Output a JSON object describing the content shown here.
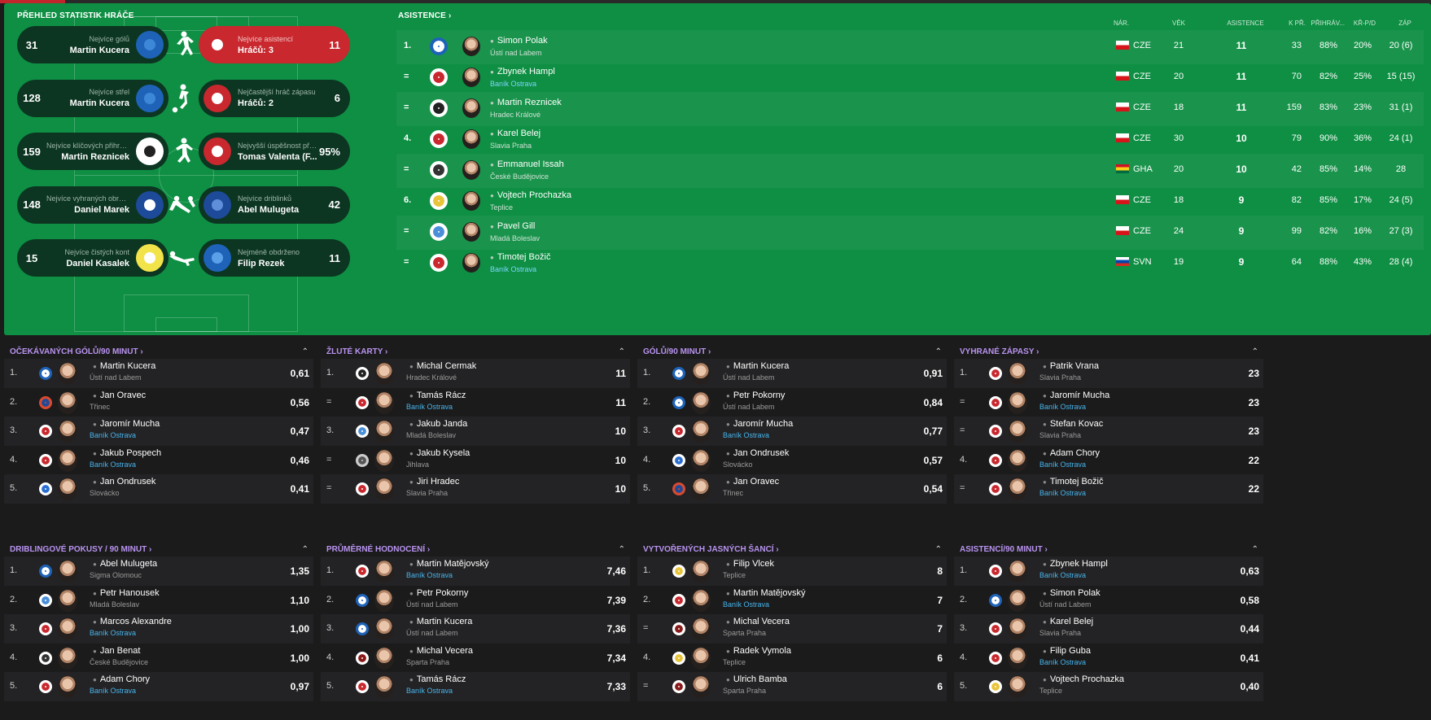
{
  "accent": {
    "green_panel": "#0e8f43",
    "red_pill": "#c8282e",
    "section_title": "#b993f0",
    "link": "#47b5ec"
  },
  "overview": {
    "title": "PŘEHLED STATISTIK HRÁČE",
    "pills": [
      {
        "label": "Nejvíce gólů",
        "name": "Martin Kucera",
        "value": "31",
        "icon": "football-player-icon"
      },
      {
        "label": "Nejvíce asistencí",
        "name": "Hráčů: 3",
        "value": "11"
      },
      {
        "label": "Nejvíce střel",
        "name": "Martin Kucera",
        "value": "128",
        "icon": "shooting-icon"
      },
      {
        "label": "Nejčastější hráč zápasu",
        "name": "Hráčů: 2",
        "value": "6"
      },
      {
        "label": "Nejvíce klíčových přihrávek",
        "name": "Martin Reznicek",
        "value": "159",
        "icon": "passing-icon"
      },
      {
        "label": "Nejvyšší úspěšnost přih...",
        "name": "Tomas Valenta (F...",
        "value": "95%"
      },
      {
        "label": "Nejvíce vyhraných obrann...",
        "name": "Daniel Marek",
        "value": "148",
        "icon": "tackle-icon"
      },
      {
        "label": "Nejvíce driblinků",
        "name": "Abel Mulugeta",
        "value": "42"
      },
      {
        "label": "Nejvíce čistých kont",
        "name": "Daniel Kasalek",
        "value": "15",
        "icon": "goalkeeper-dive-icon"
      },
      {
        "label": "Nejméně obdrženo",
        "name": "Filip Rezek",
        "value": "11"
      }
    ]
  },
  "assists": {
    "title": "ASISTENCE",
    "headers": {
      "nat": "NÁR.",
      "age": "VĚK",
      "assists": "ASISTENCE",
      "kp": "K PŘ.",
      "passes": "PŘIHRÁV...",
      "krpd": "KŘ-P/D",
      "apps": "ZÁP"
    },
    "rows": [
      {
        "pos": "1.",
        "name": "Simon Polak",
        "club": "Ústí nad Labem",
        "nat": "CZE",
        "age": "21",
        "assists": "11",
        "kp": "33",
        "passes": "88%",
        "krpd": "20%",
        "apps": "20 (6)"
      },
      {
        "pos": "=",
        "name": "Zbynek Hampl",
        "club": "Baník Ostrava",
        "nat": "CZE",
        "age": "20",
        "assists": "11",
        "kp": "70",
        "passes": "82%",
        "krpd": "25%",
        "apps": "15 (15)"
      },
      {
        "pos": "=",
        "name": "Martin Reznicek",
        "club": "Hradec Králové",
        "nat": "CZE",
        "age": "18",
        "assists": "11",
        "kp": "159",
        "passes": "83%",
        "krpd": "23%",
        "apps": "31 (1)"
      },
      {
        "pos": "4.",
        "name": "Karel Belej",
        "club": "Slavia Praha",
        "nat": "CZE",
        "age": "30",
        "assists": "10",
        "kp": "79",
        "passes": "90%",
        "krpd": "36%",
        "apps": "24 (1)"
      },
      {
        "pos": "=",
        "name": "Emmanuel Issah",
        "club": "České Budějovice",
        "nat": "GHA",
        "age": "20",
        "assists": "10",
        "kp": "42",
        "passes": "85%",
        "krpd": "14%",
        "apps": "28"
      },
      {
        "pos": "6.",
        "name": "Vojtech Prochazka",
        "club": "Teplice",
        "nat": "CZE",
        "age": "18",
        "assists": "9",
        "kp": "82",
        "passes": "85%",
        "krpd": "17%",
        "apps": "24 (5)"
      },
      {
        "pos": "=",
        "name": "Pavel Gill",
        "club": "Mladá Boleslav",
        "nat": "CZE",
        "age": "24",
        "assists": "9",
        "kp": "99",
        "passes": "82%",
        "krpd": "16%",
        "apps": "27 (3)"
      },
      {
        "pos": "=",
        "name": "Timotej Božič",
        "club": "Baník Ostrava",
        "nat": "SVN",
        "age": "19",
        "assists": "9",
        "kp": "64",
        "passes": "88%",
        "krpd": "43%",
        "apps": "28 (4)"
      }
    ]
  },
  "cards": [
    {
      "title": "OČEKÁVANÝCH GÓLŮ/90 MINUT",
      "rows": [
        {
          "rank": "1.",
          "name": "Martin Kucera",
          "club": "Ústí nad Labem",
          "value": "0,61"
        },
        {
          "rank": "2.",
          "name": "Jan Oravec",
          "club": "Třinec",
          "value": "0,56"
        },
        {
          "rank": "3.",
          "name": "Jaromír Mucha",
          "club": "Baník Ostrava",
          "value": "0,47"
        },
        {
          "rank": "4.",
          "name": "Jakub Pospech",
          "club": "Baník Ostrava",
          "value": "0,46"
        },
        {
          "rank": "5.",
          "name": "Jan Ondrusek",
          "club": "Slovácko",
          "value": "0,41"
        }
      ]
    },
    {
      "title": "ŽLUTÉ KARTY",
      "rows": [
        {
          "rank": "1.",
          "name": "Michal Cermak",
          "club": "Hradec Králové",
          "value": "11"
        },
        {
          "rank": "=",
          "name": "Tamás Rácz",
          "club": "Baník Ostrava",
          "value": "11"
        },
        {
          "rank": "3.",
          "name": "Jakub Janda",
          "club": "Mladá Boleslav",
          "value": "10"
        },
        {
          "rank": "=",
          "name": "Jakub Kysela",
          "club": "Jihlava",
          "value": "10"
        },
        {
          "rank": "=",
          "name": "Jiri Hradec",
          "club": "Slavia Praha",
          "value": "10"
        }
      ]
    },
    {
      "title": "GÓLŮ/90 MINUT",
      "rows": [
        {
          "rank": "1.",
          "name": "Martin Kucera",
          "club": "Ústí nad Labem",
          "value": "0,91"
        },
        {
          "rank": "2.",
          "name": "Petr Pokorny",
          "club": "Ústí nad Labem",
          "value": "0,84"
        },
        {
          "rank": "3.",
          "name": "Jaromír Mucha",
          "club": "Baník Ostrava",
          "value": "0,77"
        },
        {
          "rank": "4.",
          "name": "Jan Ondrusek",
          "club": "Slovácko",
          "value": "0,57"
        },
        {
          "rank": "5.",
          "name": "Jan Oravec",
          "club": "Třinec",
          "value": "0,54"
        }
      ]
    },
    {
      "title": "VYHRANÉ ZÁPASY",
      "rows": [
        {
          "rank": "1.",
          "name": "Patrik Vrana",
          "club": "Slavia Praha",
          "value": "23"
        },
        {
          "rank": "=",
          "name": "Jaromír Mucha",
          "club": "Baník Ostrava",
          "value": "23"
        },
        {
          "rank": "=",
          "name": "Stefan Kovac",
          "club": "Slavia Praha",
          "value": "23"
        },
        {
          "rank": "4.",
          "name": "Adam Chory",
          "club": "Baník Ostrava",
          "value": "22"
        },
        {
          "rank": "=",
          "name": "Timotej Božič",
          "club": "Baník Ostrava",
          "value": "22"
        }
      ]
    },
    {
      "title": "DRIBLINGOVÉ POKUSY / 90 MINUT",
      "rows": [
        {
          "rank": "1.",
          "name": "Abel Mulugeta",
          "club": "Sigma Olomouc",
          "value": "1,35"
        },
        {
          "rank": "2.",
          "name": "Petr Hanousek",
          "club": "Mladá Boleslav",
          "value": "1,10"
        },
        {
          "rank": "3.",
          "name": "Marcos Alexandre",
          "club": "Baník Ostrava",
          "value": "1,00"
        },
        {
          "rank": "4.",
          "name": "Jan Benat",
          "club": "České Budějovice",
          "value": "1,00"
        },
        {
          "rank": "5.",
          "name": "Adam Chory",
          "club": "Baník Ostrava",
          "value": "0,97"
        }
      ]
    },
    {
      "title": "PRŮMĚRNÉ HODNOCENÍ",
      "rows": [
        {
          "rank": "1.",
          "name": "Martin Matějovský",
          "club": "Baník Ostrava",
          "value": "7,46"
        },
        {
          "rank": "2.",
          "name": "Petr Pokorny",
          "club": "Ústí nad Labem",
          "value": "7,39"
        },
        {
          "rank": "3.",
          "name": "Martin Kucera",
          "club": "Ústí nad Labem",
          "value": "7,36"
        },
        {
          "rank": "4.",
          "name": "Michal Vecera",
          "club": "Sparta Praha",
          "value": "7,34"
        },
        {
          "rank": "5.",
          "name": "Tamás Rácz",
          "club": "Baník Ostrava",
          "value": "7,33"
        }
      ]
    },
    {
      "title": "VYTVOŘENÝCH JASNÝCH ŠANCÍ",
      "rows": [
        {
          "rank": "1.",
          "name": "Filip Vlcek",
          "club": "Teplice",
          "value": "8"
        },
        {
          "rank": "2.",
          "name": "Martin Matějovský",
          "club": "Baník Ostrava",
          "value": "7"
        },
        {
          "rank": "=",
          "name": "Michal Vecera",
          "club": "Sparta Praha",
          "value": "7"
        },
        {
          "rank": "4.",
          "name": "Radek Vymola",
          "club": "Teplice",
          "value": "6"
        },
        {
          "rank": "=",
          "name": "Ulrich Bamba",
          "club": "Sparta Praha",
          "value": "6"
        }
      ]
    },
    {
      "title": "ASISTENCÍ/90 MINUT",
      "rows": [
        {
          "rank": "1.",
          "name": "Zbynek Hampl",
          "club": "Baník Ostrava",
          "value": "0,63"
        },
        {
          "rank": "2.",
          "name": "Simon Polak",
          "club": "Ústí nad Labem",
          "value": "0,58"
        },
        {
          "rank": "3.",
          "name": "Karel Belej",
          "club": "Slavia Praha",
          "value": "0,44"
        },
        {
          "rank": "4.",
          "name": "Filip Guba",
          "club": "Baník Ostrava",
          "value": "0,41"
        },
        {
          "rank": "5.",
          "name": "Vojtech Prochazka",
          "club": "Teplice",
          "value": "0,40"
        }
      ]
    }
  ]
}
